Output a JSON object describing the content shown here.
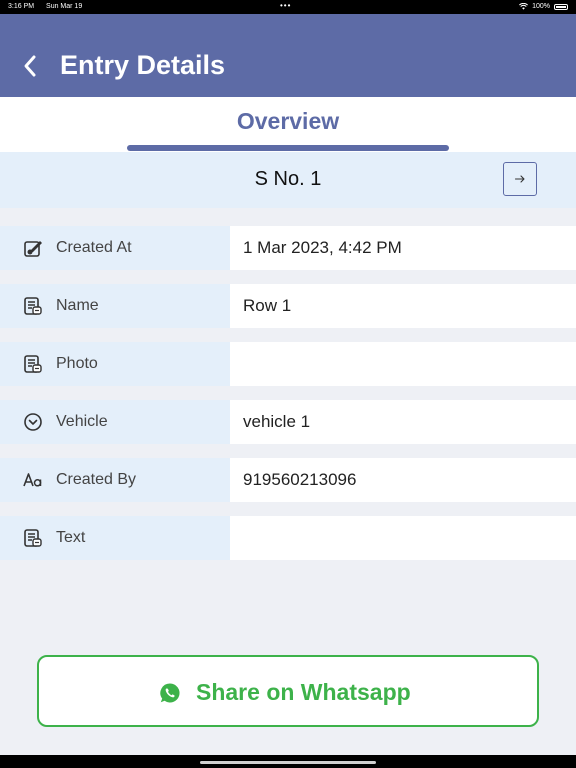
{
  "status_bar": {
    "time": "3:16 PM",
    "date": "Sun Mar 19",
    "dots": "•••",
    "battery": "100%"
  },
  "header": {
    "title": "Entry Details",
    "back_icon": "chevron-left-icon"
  },
  "tabs": {
    "active": "Overview"
  },
  "record": {
    "title": "S No. 1",
    "next_icon": "arrow-right-icon"
  },
  "rows": [
    {
      "label": "Created At",
      "value": "1 Mar 2023, 4:42 PM",
      "icon": "edit-box-icon"
    },
    {
      "label": "Name",
      "value": "Row 1",
      "icon": "document-icon"
    },
    {
      "label": "Photo",
      "value": "",
      "icon": "document-icon"
    },
    {
      "label": "Vehicle",
      "value": "vehicle 1",
      "icon": "chevron-circle-icon"
    },
    {
      "label": "Created By",
      "value": "919560213096",
      "icon": "text-aa-icon"
    },
    {
      "label": "Text",
      "value": "",
      "icon": "document-icon"
    }
  ],
  "share": {
    "label": "Share on Whatsapp",
    "icon": "whatsapp-icon"
  },
  "colors": {
    "header": "#5d6ba6",
    "label_bg": "#e4effa",
    "whatsapp_green": "#3db24a"
  }
}
